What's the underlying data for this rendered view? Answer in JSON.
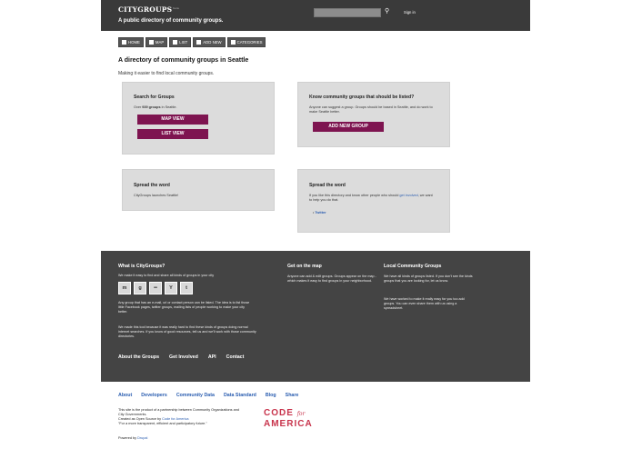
{
  "header": {
    "logo": "CITYGROUPS",
    "logo_sup": "beta",
    "tagline": "A public directory of community groups.",
    "signin": "Sign in"
  },
  "nav": [
    {
      "label": "HOME",
      "icon": "home-icon"
    },
    {
      "label": "MAP",
      "icon": "map-icon"
    },
    {
      "label": "LIST",
      "icon": "list-icon"
    },
    {
      "label": "ADD NEW",
      "icon": "plus-icon"
    },
    {
      "label": "CATEGORIES",
      "icon": "tag-icon"
    }
  ],
  "main": {
    "title": "A directory of community groups in Seattle",
    "subtitle": "Making it easier to find local community groups."
  },
  "search_panel": {
    "title": "Search for Groups",
    "text_pre": "Over ",
    "count": "939 groups",
    "text_post": " in Seattle.",
    "map_button": "MAP VIEW",
    "list_button": "LIST VIEW"
  },
  "know_panel": {
    "title": "Know community groups that should be listed?",
    "text": "Anyone can suggest a group. Groups should be based in Seattle, and do work to make Seattle better.",
    "button": "ADD NEW GROUP"
  },
  "spread1": {
    "title": "Spread the word",
    "text": "CityGroups launches Seattle!"
  },
  "spread2": {
    "title": "Spread the word",
    "text_pre": "If you like this directory and know other people who should ",
    "link": "get involved",
    "text_post": ", we want to help you do that.",
    "bullet": "Twitter"
  },
  "footer": {
    "col1_title": "What is CityGroups?",
    "col1_intro": "We make it easy to find and share all kinds of groups in your city",
    "social_icons": [
      "meetup-icon",
      "groups-icon",
      "flickr-icon",
      "yahoo-icon",
      "twitter-icon"
    ],
    "col1_p2": "Any group that has an e-mail, url or contact person can be listed. The idea is to list those little Facebook pages, twitter groups, mailing lists of people working to make your city better.",
    "col1_p3": "We made this tool because it was really hard to find these kinds of groups doing normal internet searches. If you know of good resources, tell us and we'll work with those community directories.",
    "col2_title": "Get on the map",
    "col2_text": "Anyone can add & edit groups. Groups appear on the map - which makes it easy to find groups in your neighborhood.",
    "col3_title": "Local Community Groups",
    "col3_p1": "We have all kinds of groups listed. If you don't see the kinds groups that you are looking for, let us know.",
    "col3_p2": "We have worked to make it really easy for you too add groups. You can even share them with us using a spreadsheet.",
    "links": [
      "About the Groups",
      "Get Involved",
      "API",
      "Contact"
    ]
  },
  "bottom": {
    "links": [
      "About",
      "Developers",
      "Community Data",
      "Data Standard",
      "Blog",
      "Share"
    ],
    "credits_line1": "This site is the product of a partnership between Community Organizations and City Governments.",
    "credits_line2_pre": "Created as Open Source by ",
    "credits_link": "Code for America",
    "credits_line3": "\"For a more transparent, efficient and participatory future.\"",
    "powered_pre": "Powered by ",
    "powered_link": "Drupal",
    "cfa_top": "CODE",
    "cfa_for": "for",
    "cfa_bottom": "AMERICA"
  }
}
